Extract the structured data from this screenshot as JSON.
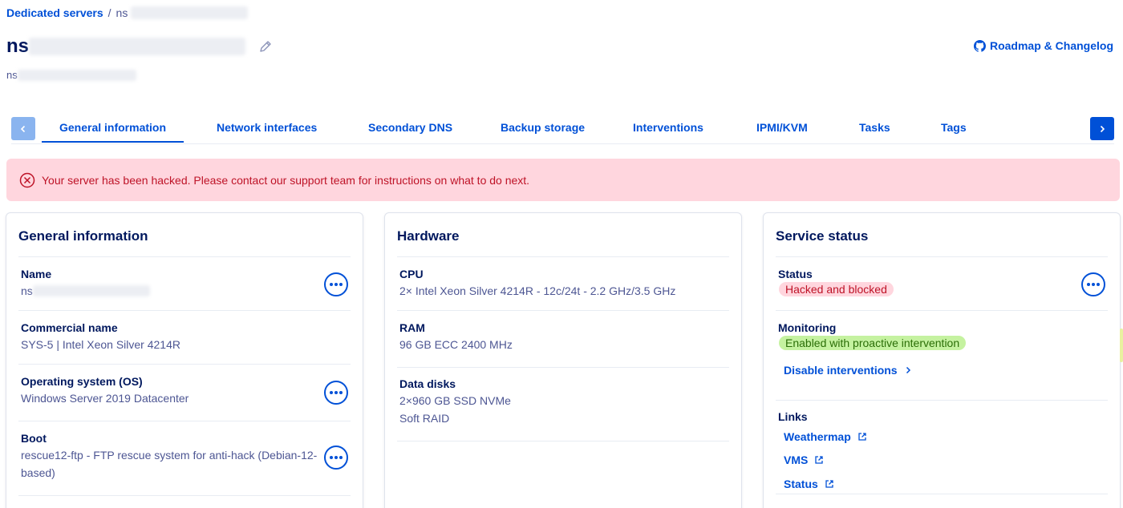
{
  "breadcrumb": {
    "parent": "Dedicated servers",
    "separator": "/",
    "current_prefix": "ns"
  },
  "header": {
    "title_prefix": "ns",
    "subtitle_prefix": "ns",
    "roadmap_label": "Roadmap & Changelog"
  },
  "tabs": {
    "items": [
      {
        "label": "General information",
        "active": true
      },
      {
        "label": "Network interfaces"
      },
      {
        "label": "Secondary DNS"
      },
      {
        "label": "Backup storage"
      },
      {
        "label": "Interventions"
      },
      {
        "label": "IPMI/KVM"
      },
      {
        "label": "Tasks"
      },
      {
        "label": "Tags"
      }
    ]
  },
  "alert": {
    "message": "Your server has been hacked. Please contact our support team for instructions on what to do next."
  },
  "general": {
    "title": "General information",
    "name_label": "Name",
    "name_prefix": "ns",
    "commercial_label": "Commercial name",
    "commercial_value": "SYS-5 | Intel Xeon Silver 4214R",
    "os_label": "Operating system (OS)",
    "os_value": "Windows Server 2019 Datacenter",
    "boot_label": "Boot",
    "boot_value_line1": "rescue12-ftp - FTP rescue system for anti-hack (Debian-12-",
    "boot_value_line2": "based)"
  },
  "hardware": {
    "title": "Hardware",
    "cpu_label": "CPU",
    "cpu_value": "2× Intel Xeon Silver 4214R - 12c/24t - 2.2 GHz/3.5 GHz",
    "ram_label": "RAM",
    "ram_value": "96 GB ECC 2400 MHz",
    "disks_label": "Data disks",
    "disks_value_line1": "2×960 GB SSD NVMe",
    "disks_value_line2": "Soft RAID"
  },
  "service": {
    "title": "Service status",
    "status_label": "Status",
    "status_badge": "Hacked and blocked",
    "monitoring_label": "Monitoring",
    "monitoring_badge": "Enabled with proactive intervention",
    "disable_link": "Disable interventions",
    "links_label": "Links",
    "links": [
      "Weathermap",
      "VMS",
      "Status"
    ]
  },
  "colors": {
    "accent": "#0050d7",
    "text": "#00185e",
    "muted": "#4d5693",
    "danger_bg": "#ffd6de",
    "danger_text": "#be1327",
    "success_bg": "#c5f2a0"
  },
  "icons": {
    "edit": "pencil-icon",
    "github": "github-icon",
    "error": "error-circle-icon",
    "more": "ellipsis-icon",
    "external": "external-link-icon"
  }
}
